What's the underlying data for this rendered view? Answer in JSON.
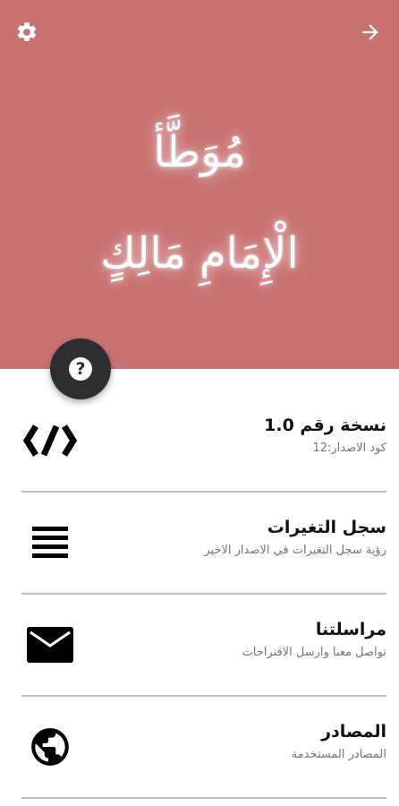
{
  "header": {
    "bg_color": "#c97272",
    "title_line1": "مُوَطَّأ",
    "title_line2": "الْإِمَامِ مَالِكٍ",
    "settings_icon": "gear-icon",
    "forward_icon": "arrow-right-icon"
  },
  "fab": {
    "icon": "help-icon",
    "glyph": "?"
  },
  "items": [
    {
      "title": "نسخة رقم 1.0",
      "subtitle": "كود الاصدار:12",
      "icon": "code-icon"
    },
    {
      "title": "سجل التغيرات",
      "subtitle": "رؤية سجل التغيرات في الاصدار الاخير",
      "icon": "list-icon"
    },
    {
      "title": "مراسلتنا",
      "subtitle": "تواصل معنا وارسل الاقتراحات",
      "icon": "mail-icon"
    },
    {
      "title": "المصادر",
      "subtitle": "المصادر المستخدمة",
      "icon": "globe-icon"
    }
  ]
}
